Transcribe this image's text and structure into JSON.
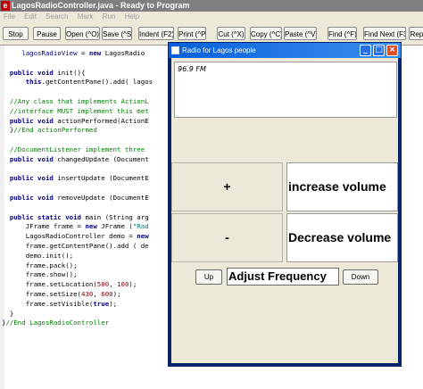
{
  "editor": {
    "title": "LagosRadioController.java - Ready to Program",
    "menu": [
      "File",
      "Edit",
      "Search",
      "Mark",
      "Run",
      "Help"
    ],
    "toolbar": [
      {
        "label": "Stop"
      },
      {
        "label": "Pause"
      },
      {
        "label": "Open (^O)"
      },
      {
        "label": "Save (^S)"
      },
      {
        "label": "Indent (F2)"
      },
      {
        "label": "Print (^P)"
      },
      {
        "label": "Cut (^X)"
      },
      {
        "label": "Copy (^C)"
      },
      {
        "label": "Paste (^V)"
      },
      {
        "label": "Find (^F)"
      },
      {
        "label": "Find Next (F3)"
      },
      {
        "label": "Rep"
      }
    ]
  },
  "radio_window": {
    "title": "Radio for Lagos people",
    "frequency_display": "96.9 FM",
    "increase_button": "+",
    "increase_label": "increase volume",
    "decrease_button": "-",
    "decrease_label": "Decrease volume",
    "up_button": "Up",
    "adjust_label": "Adjust Frequency",
    "down_button": "Down"
  },
  "colors": {
    "titlebar_active": "#0a5fd8",
    "titlebar_inactive": "#7f7f7f",
    "close_button": "#d9502d",
    "keyword": "#000080",
    "comment": "#008000",
    "string": "#008080",
    "number": "#800000"
  },
  "icons": [
    "app-icon",
    "window-icon",
    "minimize-icon",
    "maximize-icon",
    "close-icon"
  ]
}
